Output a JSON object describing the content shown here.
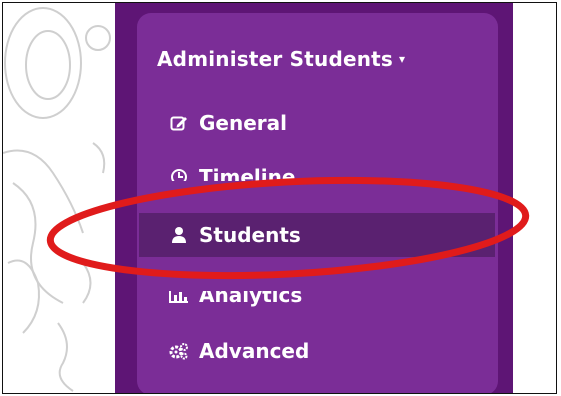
{
  "sidebar": {
    "section_title": "Administer Students",
    "section_caret": "▾",
    "items": [
      {
        "label": "General",
        "icon": "edit-icon",
        "active": false
      },
      {
        "label": "Timeline",
        "icon": "clock-icon",
        "active": false
      },
      {
        "label": "Students",
        "icon": "user-icon",
        "active": true
      },
      {
        "label": "Analytics",
        "icon": "bar-chart-icon",
        "active": false
      },
      {
        "label": "Advanced",
        "icon": "gears-icon",
        "active": false
      }
    ]
  },
  "colors": {
    "sidebar_bg": "#5e1575",
    "panel_bg": "#7b2d97",
    "active_item_bg": "#5a2170",
    "annotation_red": "#e01b1b"
  }
}
